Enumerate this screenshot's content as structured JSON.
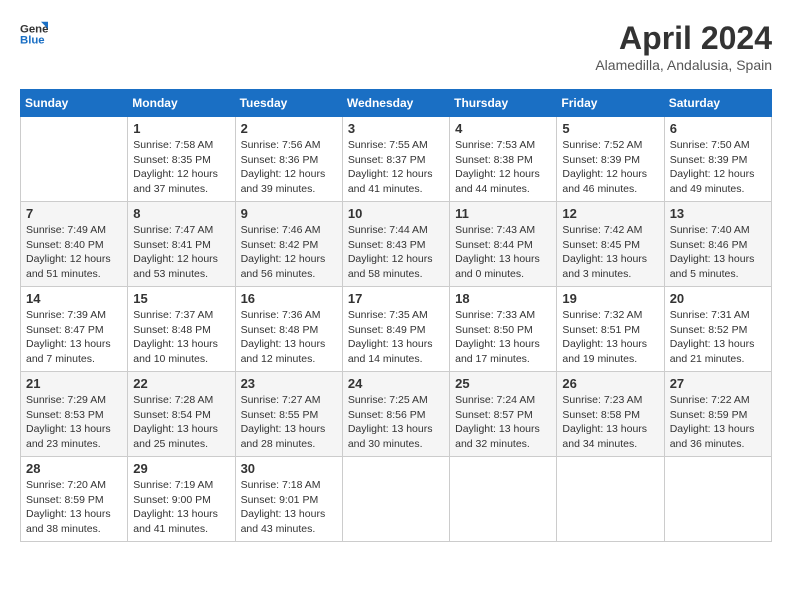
{
  "header": {
    "logo_line1": "General",
    "logo_line2": "Blue",
    "month_title": "April 2024",
    "location": "Alamedilla, Andalusia, Spain"
  },
  "days_of_week": [
    "Sunday",
    "Monday",
    "Tuesday",
    "Wednesday",
    "Thursday",
    "Friday",
    "Saturday"
  ],
  "weeks": [
    [
      {
        "day": "",
        "info": ""
      },
      {
        "day": "1",
        "info": "Sunrise: 7:58 AM\nSunset: 8:35 PM\nDaylight: 12 hours\nand 37 minutes."
      },
      {
        "day": "2",
        "info": "Sunrise: 7:56 AM\nSunset: 8:36 PM\nDaylight: 12 hours\nand 39 minutes."
      },
      {
        "day": "3",
        "info": "Sunrise: 7:55 AM\nSunset: 8:37 PM\nDaylight: 12 hours\nand 41 minutes."
      },
      {
        "day": "4",
        "info": "Sunrise: 7:53 AM\nSunset: 8:38 PM\nDaylight: 12 hours\nand 44 minutes."
      },
      {
        "day": "5",
        "info": "Sunrise: 7:52 AM\nSunset: 8:39 PM\nDaylight: 12 hours\nand 46 minutes."
      },
      {
        "day": "6",
        "info": "Sunrise: 7:50 AM\nSunset: 8:39 PM\nDaylight: 12 hours\nand 49 minutes."
      }
    ],
    [
      {
        "day": "7",
        "info": "Sunrise: 7:49 AM\nSunset: 8:40 PM\nDaylight: 12 hours\nand 51 minutes."
      },
      {
        "day": "8",
        "info": "Sunrise: 7:47 AM\nSunset: 8:41 PM\nDaylight: 12 hours\nand 53 minutes."
      },
      {
        "day": "9",
        "info": "Sunrise: 7:46 AM\nSunset: 8:42 PM\nDaylight: 12 hours\nand 56 minutes."
      },
      {
        "day": "10",
        "info": "Sunrise: 7:44 AM\nSunset: 8:43 PM\nDaylight: 12 hours\nand 58 minutes."
      },
      {
        "day": "11",
        "info": "Sunrise: 7:43 AM\nSunset: 8:44 PM\nDaylight: 13 hours\nand 0 minutes."
      },
      {
        "day": "12",
        "info": "Sunrise: 7:42 AM\nSunset: 8:45 PM\nDaylight: 13 hours\nand 3 minutes."
      },
      {
        "day": "13",
        "info": "Sunrise: 7:40 AM\nSunset: 8:46 PM\nDaylight: 13 hours\nand 5 minutes."
      }
    ],
    [
      {
        "day": "14",
        "info": "Sunrise: 7:39 AM\nSunset: 8:47 PM\nDaylight: 13 hours\nand 7 minutes."
      },
      {
        "day": "15",
        "info": "Sunrise: 7:37 AM\nSunset: 8:48 PM\nDaylight: 13 hours\nand 10 minutes."
      },
      {
        "day": "16",
        "info": "Sunrise: 7:36 AM\nSunset: 8:48 PM\nDaylight: 13 hours\nand 12 minutes."
      },
      {
        "day": "17",
        "info": "Sunrise: 7:35 AM\nSunset: 8:49 PM\nDaylight: 13 hours\nand 14 minutes."
      },
      {
        "day": "18",
        "info": "Sunrise: 7:33 AM\nSunset: 8:50 PM\nDaylight: 13 hours\nand 17 minutes."
      },
      {
        "day": "19",
        "info": "Sunrise: 7:32 AM\nSunset: 8:51 PM\nDaylight: 13 hours\nand 19 minutes."
      },
      {
        "day": "20",
        "info": "Sunrise: 7:31 AM\nSunset: 8:52 PM\nDaylight: 13 hours\nand 21 minutes."
      }
    ],
    [
      {
        "day": "21",
        "info": "Sunrise: 7:29 AM\nSunset: 8:53 PM\nDaylight: 13 hours\nand 23 minutes."
      },
      {
        "day": "22",
        "info": "Sunrise: 7:28 AM\nSunset: 8:54 PM\nDaylight: 13 hours\nand 25 minutes."
      },
      {
        "day": "23",
        "info": "Sunrise: 7:27 AM\nSunset: 8:55 PM\nDaylight: 13 hours\nand 28 minutes."
      },
      {
        "day": "24",
        "info": "Sunrise: 7:25 AM\nSunset: 8:56 PM\nDaylight: 13 hours\nand 30 minutes."
      },
      {
        "day": "25",
        "info": "Sunrise: 7:24 AM\nSunset: 8:57 PM\nDaylight: 13 hours\nand 32 minutes."
      },
      {
        "day": "26",
        "info": "Sunrise: 7:23 AM\nSunset: 8:58 PM\nDaylight: 13 hours\nand 34 minutes."
      },
      {
        "day": "27",
        "info": "Sunrise: 7:22 AM\nSunset: 8:59 PM\nDaylight: 13 hours\nand 36 minutes."
      }
    ],
    [
      {
        "day": "28",
        "info": "Sunrise: 7:20 AM\nSunset: 8:59 PM\nDaylight: 13 hours\nand 38 minutes."
      },
      {
        "day": "29",
        "info": "Sunrise: 7:19 AM\nSunset: 9:00 PM\nDaylight: 13 hours\nand 41 minutes."
      },
      {
        "day": "30",
        "info": "Sunrise: 7:18 AM\nSunset: 9:01 PM\nDaylight: 13 hours\nand 43 minutes."
      },
      {
        "day": "",
        "info": ""
      },
      {
        "day": "",
        "info": ""
      },
      {
        "day": "",
        "info": ""
      },
      {
        "day": "",
        "info": ""
      }
    ]
  ]
}
